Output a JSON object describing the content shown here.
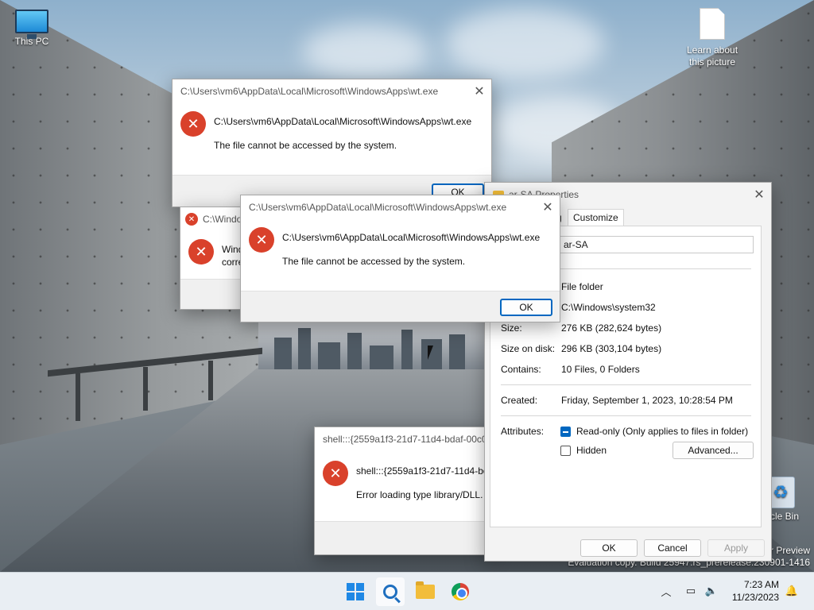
{
  "desktop": {
    "icons": {
      "this_pc": "This PC",
      "learn_line1": "Learn about",
      "learn_line2": "this picture",
      "recycle_bin": "cle Bin"
    },
    "watermark": {
      "line1": "r Preview",
      "line2": "Evaluation copy. Build 25947.rs_prerelease.230901-1416"
    }
  },
  "dialogs": {
    "wt_back": {
      "title": "C:\\Users\\vm6\\AppData\\Local\\Microsoft\\WindowsApps\\wt.exe",
      "heading": "C:\\Users\\vm6\\AppData\\Local\\Microsoft\\WindowsApps\\wt.exe",
      "message": "The file cannot be accessed by the system.",
      "ok_label": "OK"
    },
    "windows_partial": {
      "title": "C:\\Windo",
      "line1": "Wind",
      "line2": "corre"
    },
    "wt_front": {
      "title": "C:\\Users\\vm6\\AppData\\Local\\Microsoft\\WindowsApps\\wt.exe",
      "heading": "C:\\Users\\vm6\\AppData\\Local\\Microsoft\\WindowsApps\\wt.exe",
      "message": "The file cannot be accessed by the system.",
      "ok_label": "OK"
    },
    "shell": {
      "title": "shell:::{2559a1f3-21d7-11d4-bdaf-00c0",
      "heading": "shell:::{2559a1f3-21d7-11d4-bd",
      "message": "Error loading type library/DLL."
    }
  },
  "properties": {
    "title": "ar-SA Properties",
    "tabs": [
      "g",
      "Customize"
    ],
    "name_value": "ar-SA",
    "rows": {
      "type_value": "File folder",
      "location_value": "C:\\Windows\\system32",
      "size_label": "Size:",
      "size_value": "276 KB (282,624 bytes)",
      "size_on_disk_label": "Size on disk:",
      "size_on_disk_value": "296 KB (303,104 bytes)",
      "contains_label": "Contains:",
      "contains_value": "10 Files, 0 Folders",
      "created_label": "Created:",
      "created_value": "Friday, September 1, 2023, 10:28:54 PM",
      "attributes_label": "Attributes:",
      "readonly_label": "Read-only (Only applies to files in folder)",
      "hidden_label": "Hidden",
      "advanced_label": "Advanced..."
    },
    "buttons": {
      "ok": "OK",
      "cancel": "Cancel",
      "apply": "Apply"
    }
  },
  "taskbar": {
    "apps": [
      "start-icon",
      "search-icon",
      "file-explorer-icon",
      "chrome-icon"
    ],
    "time": "7:23 AM",
    "date": "11/23/2023"
  },
  "colors": {
    "accent": "#0067c0",
    "error": "#d9412b"
  }
}
